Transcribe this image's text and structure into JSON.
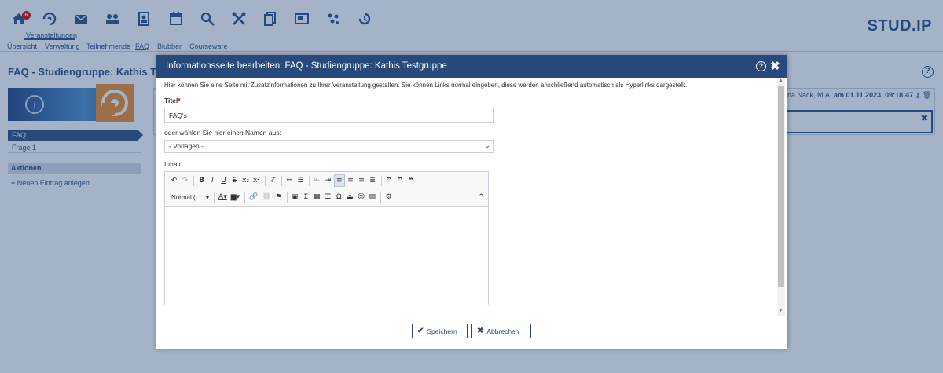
{
  "topnav": {
    "home_badge": "6",
    "active_label": "Veranstaltungen",
    "icons": [
      "home-icon",
      "courses-icon",
      "messages-icon",
      "community-icon",
      "profile-icon",
      "planner-icon",
      "search-icon",
      "tools-icon",
      "files-icon",
      "slides-icon",
      "contacts-icon",
      "history-icon"
    ],
    "logo": "STUD.IP"
  },
  "subnav": {
    "items": [
      "Übersicht",
      "Verwaltung",
      "Teilnehmende",
      "FAQ",
      "Blubber",
      "Courseware"
    ],
    "active": "FAQ"
  },
  "page": {
    "title": "FAQ - Studiengruppe: Kathis Testgr",
    "sidebar": {
      "active_item": "FAQ",
      "item": "Frage 1",
      "actions_heading": "Aktionen",
      "action_new": "Neuen Eintrag anlegen"
    },
    "author_prefix": "ina Nack, M.A.",
    "author_date": "am 01.11.2023, 09:18:47"
  },
  "dialog": {
    "title": "Informationsseite bearbeiten: FAQ - Studiengruppe: Kathis Testgruppe",
    "intro": "Hier können Sie eine Seite mit Zusatzinformationen zu Ihrer Veranstaltung gestalten. Sie können Links normal eingeben, diese werden anschließend automatisch als Hyperlinks dargestellt.",
    "title_label": "Titel",
    "title_value": "FAQ's",
    "choose_label": "oder wählen Sie hier einen Namen aus:",
    "template_select": "- Vorlagen -",
    "content_label": "Inhalt",
    "format_combo": "Normal (...",
    "save_button": "Speichern",
    "cancel_button": "Abbrechen"
  },
  "colors": {
    "brand": "#28497c",
    "required": "#d60000",
    "avatar": "#f08a24"
  }
}
